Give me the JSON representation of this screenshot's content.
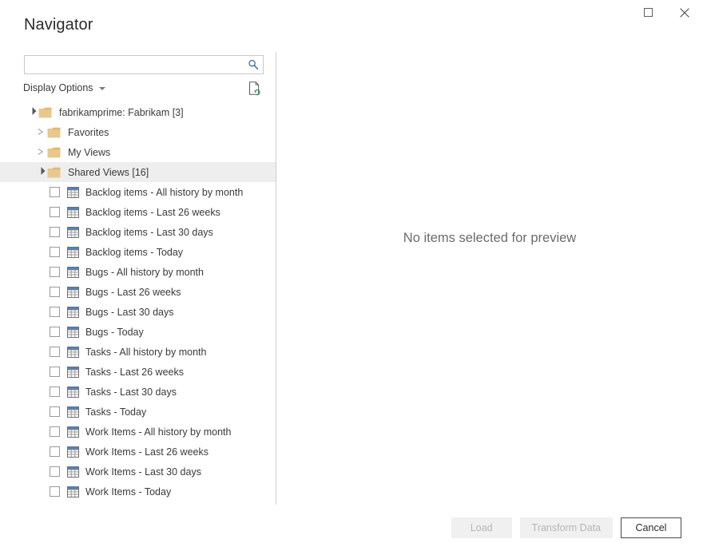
{
  "window": {
    "title": "Navigator",
    "controls": [
      {
        "name": "maximize-button",
        "icon": "maximize-icon"
      },
      {
        "name": "close-button",
        "icon": "close-icon"
      }
    ]
  },
  "search": {
    "value": "",
    "placeholder": "",
    "icon": "search-icon"
  },
  "display_options": {
    "label": "Display Options",
    "caret_icon": "chevron-down-icon"
  },
  "refresh_icon": "refresh-document-icon",
  "tree": {
    "root": {
      "label": "fabrikamprime: Fabrikam [3]",
      "expanded": true,
      "icon": "folder-icon"
    },
    "groups": [
      {
        "label": "Favorites",
        "expanded": false,
        "selected": false,
        "icon": "folder-icon"
      },
      {
        "label": "My Views",
        "expanded": false,
        "selected": false,
        "icon": "folder-icon"
      },
      {
        "label": "Shared Views [16]",
        "expanded": true,
        "selected": true,
        "icon": "folder-icon"
      }
    ],
    "items": [
      {
        "label": "Backlog items - All history by month",
        "checked": false,
        "icon": "table-icon"
      },
      {
        "label": "Backlog items - Last 26 weeks",
        "checked": false,
        "icon": "table-icon"
      },
      {
        "label": "Backlog items - Last 30 days",
        "checked": false,
        "icon": "table-icon"
      },
      {
        "label": "Backlog items - Today",
        "checked": false,
        "icon": "table-icon"
      },
      {
        "label": "Bugs - All history by month",
        "checked": false,
        "icon": "table-icon"
      },
      {
        "label": "Bugs - Last 26 weeks",
        "checked": false,
        "icon": "table-icon"
      },
      {
        "label": "Bugs - Last 30 days",
        "checked": false,
        "icon": "table-icon"
      },
      {
        "label": "Bugs - Today",
        "checked": false,
        "icon": "table-icon"
      },
      {
        "label": "Tasks - All history by month",
        "checked": false,
        "icon": "table-icon"
      },
      {
        "label": "Tasks - Last 26 weeks",
        "checked": false,
        "icon": "table-icon"
      },
      {
        "label": "Tasks - Last 30 days",
        "checked": false,
        "icon": "table-icon"
      },
      {
        "label": "Tasks - Today",
        "checked": false,
        "icon": "table-icon"
      },
      {
        "label": "Work Items - All history by month",
        "checked": false,
        "icon": "table-icon"
      },
      {
        "label": "Work Items - Last 26 weeks",
        "checked": false,
        "icon": "table-icon"
      },
      {
        "label": "Work Items - Last 30 days",
        "checked": false,
        "icon": "table-icon"
      },
      {
        "label": "Work Items - Today",
        "checked": false,
        "icon": "table-icon"
      }
    ]
  },
  "preview": {
    "empty_message": "No items selected for preview"
  },
  "footer": {
    "load_label": "Load",
    "transform_label": "Transform Data",
    "cancel_label": "Cancel"
  },
  "colors": {
    "folder": "#e9c88c",
    "folder_tab": "#dfb977",
    "table_header": "#4a84c4",
    "search_icon": "#3a6ea5",
    "selection": "#eeeeee",
    "divider": "#cfcfcf",
    "text": "#3a3a3a",
    "disabled_text": "#b6b6b6"
  }
}
